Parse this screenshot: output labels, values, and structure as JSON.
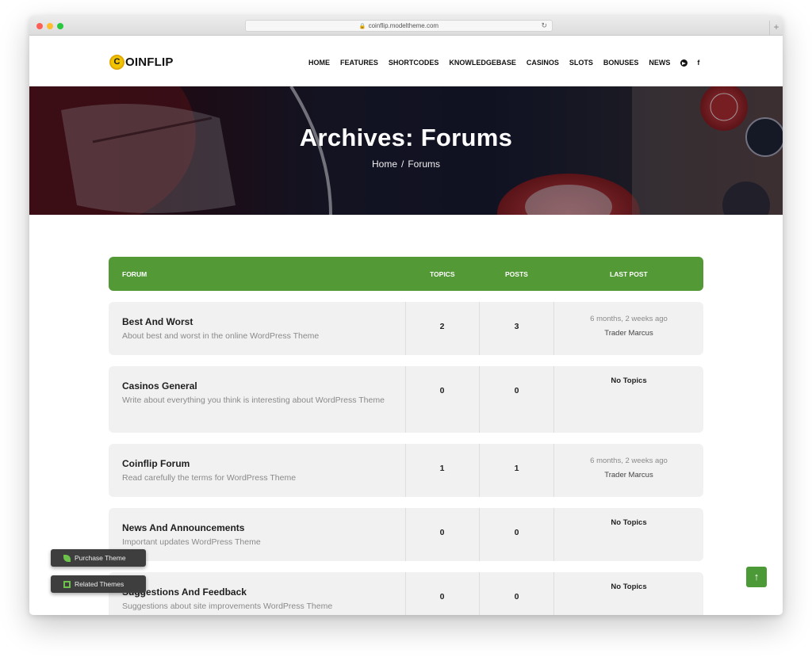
{
  "browser": {
    "url": "coinflip.modeltheme.com"
  },
  "header": {
    "logo_text": "OINFLIP",
    "logo_letter": "C",
    "nav": [
      "HOME",
      "FEATURES",
      "SHORTCODES",
      "KNOWLEDGEBASE",
      "CASINOS",
      "SLOTS",
      "BONUSES",
      "NEWS"
    ]
  },
  "hero": {
    "title": "Archives: Forums",
    "breadcrumb_home": "Home",
    "breadcrumb_sep": "/",
    "breadcrumb_current": "Forums"
  },
  "table": {
    "headers": {
      "forum": "FORUM",
      "topics": "TOPICS",
      "posts": "POSTS",
      "last_post": "LAST POST"
    },
    "rows": [
      {
        "title": "Best And Worst",
        "desc": "About best and worst in the online WordPress Theme",
        "topics": "2",
        "posts": "3",
        "last_time": "6 months, 2 weeks ago",
        "last_by": "Trader Marcus"
      },
      {
        "title": "Casinos General",
        "desc": "Write about everything you think is interesting about WordPress Theme",
        "topics": "0",
        "posts": "0",
        "last_text": "No Topics"
      },
      {
        "title": "Coinflip Forum",
        "desc": "Read carefully the terms for WordPress Theme",
        "topics": "1",
        "posts": "1",
        "last_time": "6 months, 2 weeks ago",
        "last_by": "Trader Marcus"
      },
      {
        "title": "News And Announcements",
        "desc": "Important updates WordPress Theme",
        "topics": "0",
        "posts": "0",
        "last_text": "No Topics"
      },
      {
        "title": "Suggestions And Feedback",
        "desc": "Suggestions about site improvements WordPress Theme",
        "topics": "0",
        "posts": "0",
        "last_text": "No Topics"
      }
    ]
  },
  "floating": {
    "purchase": "Purchase Theme",
    "related": "Related Themes",
    "scroll_top": "↑"
  },
  "colors": {
    "accent_green": "#539a37",
    "logo_yellow": "#f2c400"
  }
}
